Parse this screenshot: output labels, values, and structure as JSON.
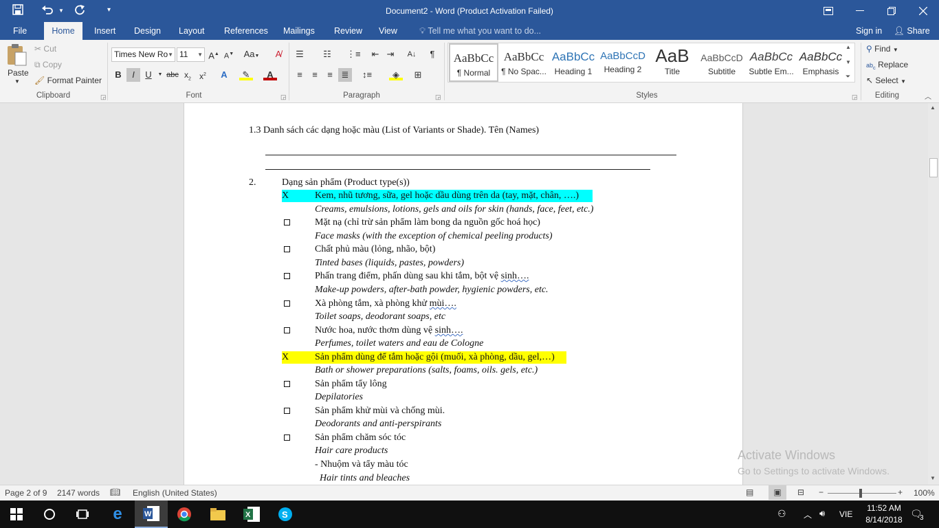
{
  "window": {
    "title": "Document2 - Word (Product Activation Failed)"
  },
  "tabs": [
    {
      "label": "File"
    },
    {
      "label": "Home"
    },
    {
      "label": "Insert"
    },
    {
      "label": "Design"
    },
    {
      "label": "Layout"
    },
    {
      "label": "References"
    },
    {
      "label": "Mailings"
    },
    {
      "label": "Review"
    },
    {
      "label": "View"
    }
  ],
  "tell_me": "Tell me what you want to do...",
  "account": {
    "signin": "Sign in",
    "share": "Share"
  },
  "clipboard": {
    "paste": "Paste",
    "cut": "Cut",
    "copy": "Copy",
    "format_painter": "Format Painter",
    "label": "Clipboard"
  },
  "font": {
    "name": "Times New Ro",
    "size": "11",
    "label": "Font",
    "case_btn": "Aa"
  },
  "paragraph": {
    "label": "Paragraph"
  },
  "styles": {
    "label": "Styles",
    "items": [
      {
        "sample": "AaBbCc",
        "name": "¶ Normal"
      },
      {
        "sample": "AaBbCc",
        "name": "¶ No Spac..."
      },
      {
        "sample": "AaBbCc",
        "name": "Heading 1"
      },
      {
        "sample": "AaBbCcD",
        "name": "Heading 2"
      },
      {
        "sample": "AaB",
        "name": "Title"
      },
      {
        "sample": "AaBbCcD",
        "name": "Subtitle"
      },
      {
        "sample": "AaBbCc",
        "name": "Subtle Em..."
      },
      {
        "sample": "AaBbCc",
        "name": "Emphasis"
      }
    ]
  },
  "editing": {
    "find": "Find",
    "replace": "Replace",
    "select": "Select",
    "label": "Editing"
  },
  "document": {
    "line_13": "1.3    Danh sách các dạng hoặc màu (List of Variants or Shade). Tên (Names)",
    "sec2_num": "2.",
    "sec2_title": "Dạng sản phẩm (Product type(s))",
    "x_mark": "X",
    "items": [
      {
        "vi": "Kem, nhũ tương, sữa, gel hoặc dầu dùng trên da (tay, mặt, chân, ….)",
        "en": "Creams, emulsions, lotions, gels and oils for skin (hands, face, feet, etc.)"
      },
      {
        "vi": "Mặt nạ (chỉ trừ sản phẩm làm bong da nguồn gốc hoá học)",
        "en": "Face masks (with the exception of chemical peeling products)"
      },
      {
        "vi": "Chất phủ màu (lỏng, nhão, bột)",
        "en": "Tinted bases (liquids, pastes, powders)"
      },
      {
        "vi": "Phấn trang điểm, phấn dùng sau khi tắm, bột vệ",
        "vi_sq": "sinh….",
        "en": "Make-up powders, after-bath powder, hygienic powders, etc."
      },
      {
        "vi": "Xà phòng tắm, xà phòng khử",
        "vi_sq": "mùi….",
        "en": "Toilet soaps, deodorant soaps, etc"
      },
      {
        "vi": "Nước hoa, nước thơm dùng vệ",
        "vi_sq": "sinh….",
        "en": "Perfumes, toilet waters and eau de Cologne"
      },
      {
        "vi": "Sản phẩm dùng để tắm hoặc gội (muối, xà phòng, dầu, gel,…)",
        "en": "Bath or shower preparations (salts, foams, oils. gels, etc.)"
      },
      {
        "vi": "Sản phẩm tẩy lông",
        "en": "Depilatories"
      },
      {
        "vi": "Sản phẩm khử mùi và chống mùi.",
        "en": "Deodorants and anti-perspirants"
      },
      {
        "vi": "Sản phẩm chăm sóc tóc",
        "en": "Hair care products"
      }
    ],
    "sub_vi": "- Nhuộm và tẩy màu tóc",
    "sub_en": "Hair tints and bleaches"
  },
  "watermark": {
    "line1": "Activate Windows",
    "line2": "Go to Settings to activate Windows."
  },
  "status": {
    "page": "Page 2 of 9",
    "words": "2147 words",
    "language": "English (United States)",
    "zoom": "100%"
  },
  "taskbar": {
    "lang": "VIE",
    "time": "11:52 AM",
    "date": "8/14/2018",
    "notif": "3"
  }
}
